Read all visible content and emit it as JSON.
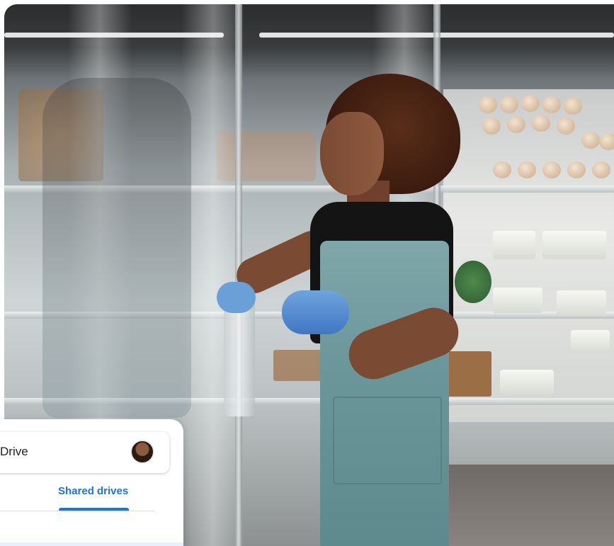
{
  "search": {
    "text": "Drive",
    "avatar_icon": "user-avatar"
  },
  "tabs": [
    {
      "label": "Shared drives",
      "selected": true
    }
  ],
  "colors": {
    "accent": "#1a73e8",
    "card": "#ffffff",
    "apron": "#6c979a",
    "glove": "#4a86cf"
  }
}
